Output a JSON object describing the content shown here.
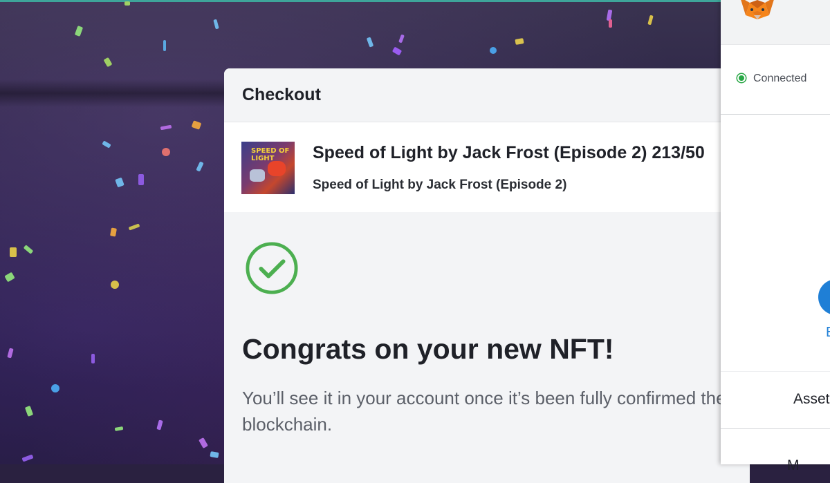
{
  "checkout": {
    "title": "Checkout",
    "product_title": "Speed of Light by Jack Frost (Episode 2) 213/50",
    "product_subtitle": "Speed of Light by Jack Frost (Episode 2)",
    "thumbnail_text": "SPEED OF LIGHT"
  },
  "success": {
    "heading": "Congrats on your new NFT!",
    "message": "You’ll see it in your account once it’s been fully confirmed the blockchain."
  },
  "wallet": {
    "status": "Connected",
    "avatar_label": "E",
    "assets_label": "Asset",
    "more_label": "M",
    "status_color": "#28a745",
    "accent_color": "#1f7fd6",
    "logo_icon": "metamask-fox-icon"
  },
  "colors": {
    "top_accent": "#3ea59a",
    "success_green": "#4caf50"
  }
}
